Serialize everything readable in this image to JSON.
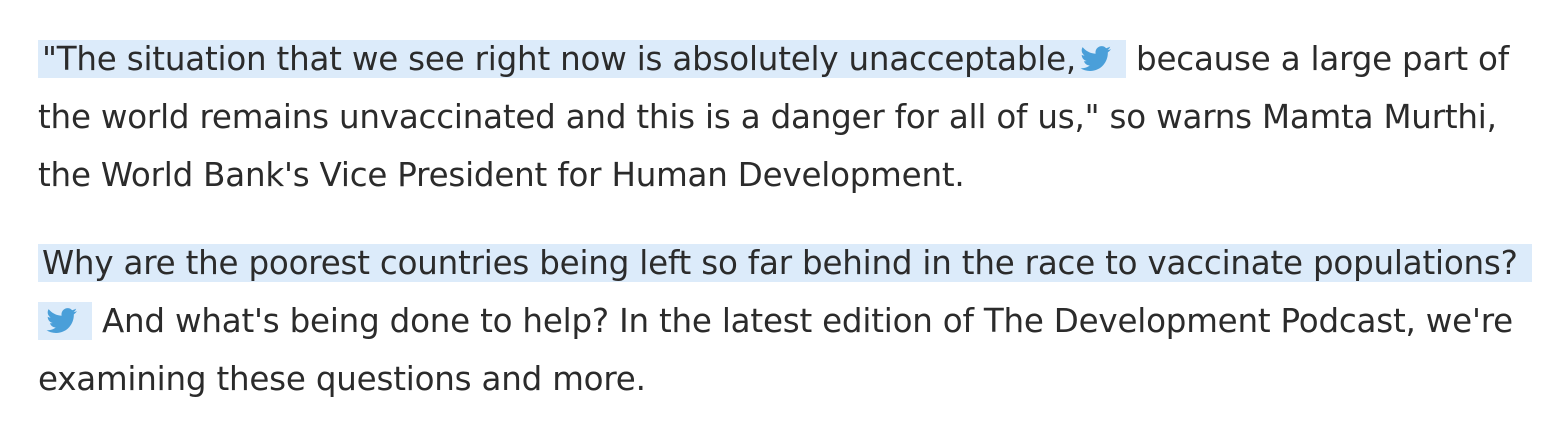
{
  "article": {
    "paragraphs": [
      {
        "tweet_text": "\"The situation that we see right now is absolutely unacceptable,",
        "rest_text": "because a large part of the world remains unvaccinated and this is a danger for all of us,\" so warns Mamta Murthi, the World Bank's Vice President for Human Development."
      },
      {
        "tweet_text": "Why are the poorest countries being left so far behind in the race to vaccinate populations?",
        "rest_text": "And what's being done to help?  In the latest edition of The Development Podcast, we're examining these questions and more."
      }
    ]
  },
  "icons": {
    "tweet": "twitter-bird-icon"
  },
  "colors": {
    "text": "#2b2b2b",
    "tweet_highlight": "#dcebfa",
    "twitter_blue": "#4a9fd9"
  }
}
